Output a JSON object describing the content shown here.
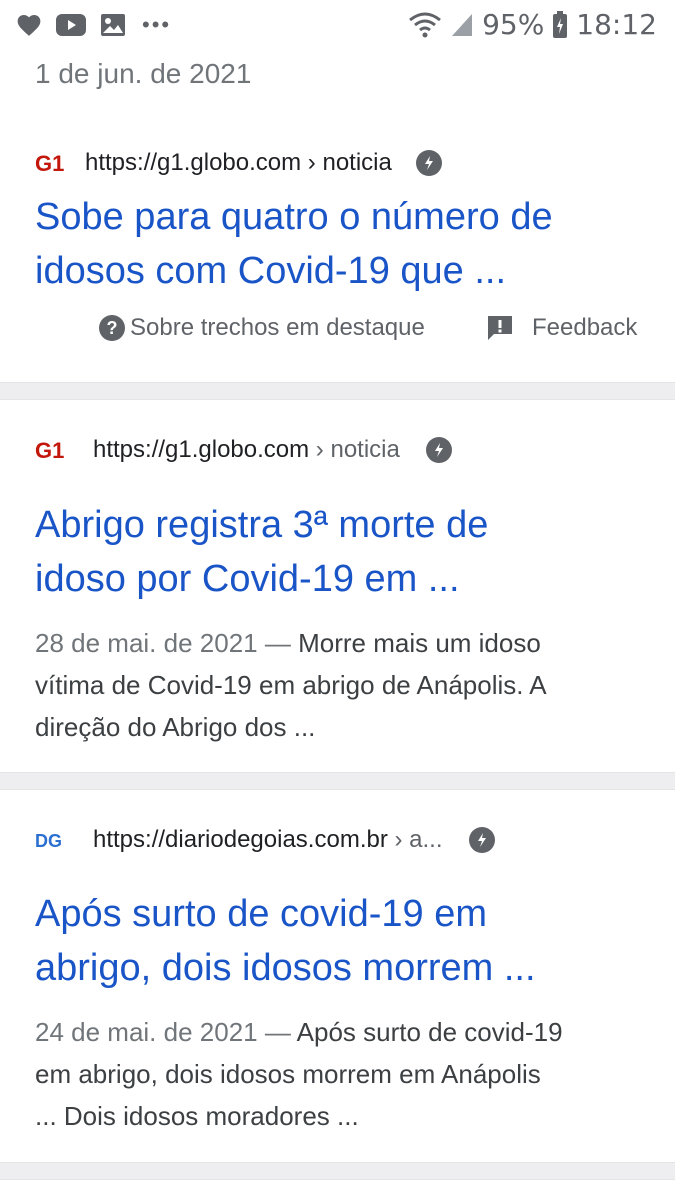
{
  "status_bar": {
    "battery": "95%",
    "time": "18:12",
    "left_icons": [
      "heart-icon",
      "youtube-icon",
      "gallery-icon",
      "more-dots-icon"
    ],
    "right_icons": [
      "wifi-icon",
      "signal-icon",
      "battery-icon"
    ]
  },
  "result1": {
    "date": "1 de jun. de 2021",
    "source": {
      "favicon": "G1",
      "url": "https://g1.globo.com",
      "path": " › noticia"
    },
    "title_line1": "Sobe para quatro o número de",
    "title_line2": "idosos com Covid-19 que ...",
    "about_label": "Sobre trechos em destaque",
    "feedback_label": "Feedback"
  },
  "result2": {
    "source": {
      "favicon": "G1",
      "url": "https://g1.globo.com",
      "path": " › noticia"
    },
    "title_line1": "Abrigo registra 3ª morte de",
    "title_line2": "idoso por Covid-19 em ...",
    "date": "28 de mai. de 2021",
    "dash": " — ",
    "snippet_line1": "Morre mais um idoso",
    "snippet_line2": "vítima de Covid-19 em abrigo de Anápolis. A",
    "snippet_line3": "direção do Abrigo dos ..."
  },
  "result3": {
    "source": {
      "favicon": "DG",
      "url": "https://diariodegoias.com.br",
      "path": " › a..."
    },
    "title_line1": "Após surto de covid-19 em",
    "title_line2": "abrigo, dois idosos morrem ...",
    "date": "24 de mai. de 2021",
    "dash": " — ",
    "snippet_line1": "Após surto de covid-19",
    "snippet_line2": "em abrigo, dois idosos morrem em Anápolis",
    "snippet_line3": "... Dois idosos moradores ..."
  },
  "colors": {
    "link": "#1a55c8",
    "g1_red": "#c4170c",
    "dg_blue": "#2b6fd1",
    "separator": "#eeeef0"
  }
}
